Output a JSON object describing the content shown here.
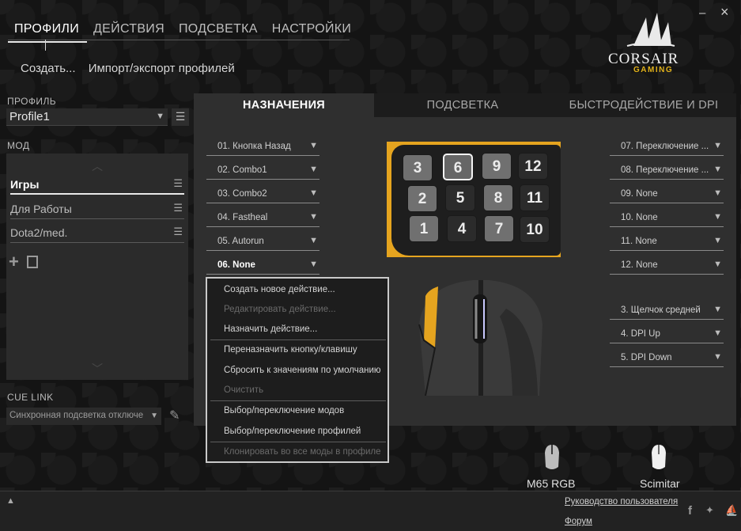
{
  "topnav": {
    "tabs": [
      "ПРОФИЛИ",
      "ДЕЙСТВИЯ",
      "ПОДСВЕТКА",
      "НАСТРОЙКИ"
    ],
    "active": "ПРОФИЛИ"
  },
  "subnav": {
    "create": "Создать...",
    "import_export": "Импорт/экспорт профилей"
  },
  "logo": {
    "brand": "CORSAIR",
    "sub": "GAMING"
  },
  "window": {
    "minimize": "–",
    "close": "×"
  },
  "left": {
    "profile_label": "ПРОФИЛЬ",
    "profile_value": "Profile1",
    "mod_label": "МОД",
    "mods": [
      {
        "label": "Игры",
        "active": true
      },
      {
        "label": "Для Работы",
        "active": false
      },
      {
        "label": "Dota2/med.",
        "active": false
      }
    ],
    "cue_link_label": "CUE LINK",
    "cue_link_value": "Синхронная подсветка отключе"
  },
  "main_tabs": [
    "НАЗНАЧЕНИЯ",
    "ПОДСВЕТКА",
    "БЫСТРОДЕЙСТВИЕ И DPI"
  ],
  "assign_left": [
    "01. Кнопка Назад",
    "02. Combo1",
    "03. Combo2",
    "04. Fastheal",
    "05. Autorun",
    "06. None"
  ],
  "assign_right_top": [
    "07. Переключение ...",
    "08. Переключение ...",
    "09. None",
    "10. None",
    "11. None",
    "12. None"
  ],
  "assign_right_bottom": [
    "3. Щелчок средней",
    "4. DPI Up",
    "5. DPI Down"
  ],
  "context_menu": [
    {
      "label": "Создать новое действие...",
      "disabled": false
    },
    {
      "label": "Редактировать действие...",
      "disabled": true
    },
    {
      "label": "Назначить действие...",
      "disabled": false
    },
    {
      "label": "Переназначить кнопку/клавишу",
      "disabled": false
    },
    {
      "label": "Сбросить к значениям по умолчанию",
      "disabled": false
    },
    {
      "label": "Очистить",
      "disabled": true
    },
    {
      "label": "Выбор/переключение модов",
      "disabled": false
    },
    {
      "label": "Выбор/переключение профилей",
      "disabled": false
    },
    {
      "label": "Клонировать во все моды в профиле",
      "disabled": true
    }
  ],
  "keypad_keys": [
    "3",
    "6",
    "9",
    "12",
    "2",
    "5",
    "8",
    "11",
    "1",
    "4",
    "7",
    "10"
  ],
  "devices": [
    "M65 RGB",
    "Scimitar"
  ],
  "footer": {
    "manual": "Руководство пользователя",
    "forum": "Форум"
  },
  "colors": {
    "accent": "#e5a41f",
    "panel": "#2f2f2f",
    "background": "#161616"
  }
}
